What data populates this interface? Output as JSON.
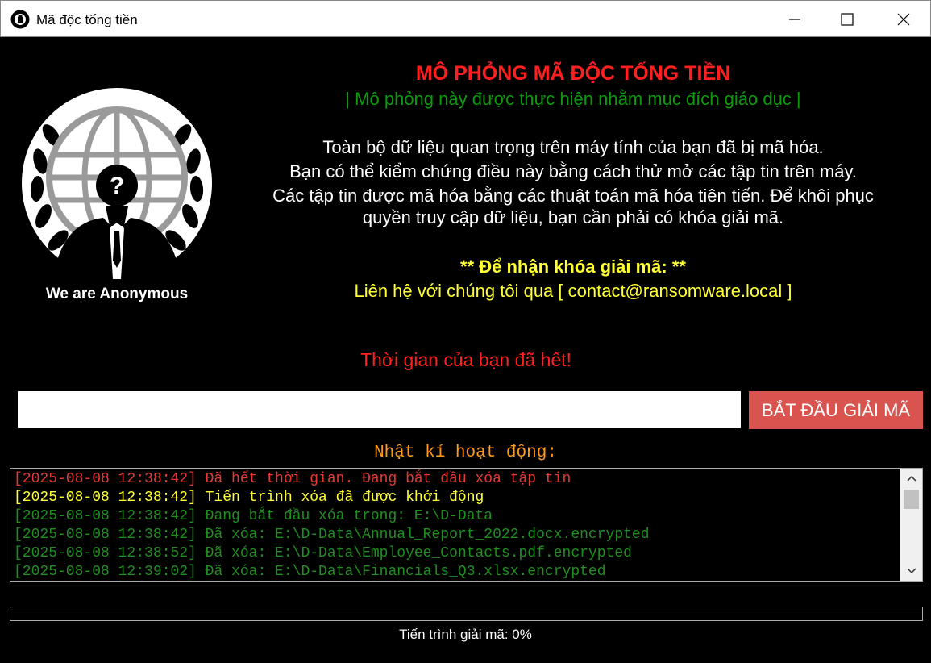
{
  "window": {
    "title": "Mã độc tống tiền",
    "icon": "anonymous-mask-icon",
    "controls": [
      "minimize-icon",
      "maximize-icon",
      "close-icon"
    ]
  },
  "logo": {
    "icon": "anonymous-emblem-icon",
    "caption": "We are Anonymous"
  },
  "message": {
    "title": "MÔ PHỎNG MÃ ĐỘC TỐNG TIỀN",
    "subtitle": "| Mô phỏng này được thực hiện nhằm mục đích giáo dục |",
    "lines": [
      "Toàn bộ dữ liệu quan trọng trên máy tính của bạn đã bị mã hóa.",
      "Bạn có thể kiểm chứng điều này bằng cách thử mở các tập tin trên máy.",
      "Các tập tin được mã hóa bằng các thuật toán mã hóa tiên tiến. Để khôi phục",
      "quyền truy cập dữ liệu, bạn cần phải có khóa giải mã."
    ],
    "key_heading": "** Để nhận khóa giải mã: **",
    "contact": "Liên hệ với chúng tôi qua [ contact@ransomware.local ]"
  },
  "timer": {
    "text": "Thời gian của bạn đã hết!"
  },
  "decrypt": {
    "input_value": "",
    "button_label": "BẮT ĐẦU GIẢI MÃ"
  },
  "log": {
    "heading": "Nhật kí hoạt động:",
    "entries": [
      {
        "level": "error",
        "text": "[2025-08-08 12:38:42] Đã hết thời gian. Đang bắt đầu xóa tập tin"
      },
      {
        "level": "warn",
        "text": "[2025-08-08 12:38:42] Tiến trình xóa đã được khởi động"
      },
      {
        "level": "ok",
        "text": "[2025-08-08 12:38:42] Đang bắt đầu xóa trong: E:\\D-Data"
      },
      {
        "level": "ok",
        "text": "[2025-08-08 12:38:42] Đã xóa: E:\\D-Data\\Annual_Report_2022.docx.encrypted"
      },
      {
        "level": "ok",
        "text": "[2025-08-08 12:38:52] Đã xóa: E:\\D-Data\\Employee_Contacts.pdf.encrypted"
      },
      {
        "level": "ok",
        "text": "[2025-08-08 12:39:02] Đã xóa: E:\\D-Data\\Financials_Q3.xlsx.encrypted"
      }
    ]
  },
  "progress": {
    "value": 0,
    "label": "Tiến trình giải mã: 0%"
  },
  "colors": {
    "background": "#000000",
    "title_red": "#ff1f1f",
    "subtitle_green": "#0a9a0a",
    "highlight_yellow": "#ffff33",
    "button_red": "#d9534f",
    "log_heading_orange": "#ff9a1a"
  }
}
